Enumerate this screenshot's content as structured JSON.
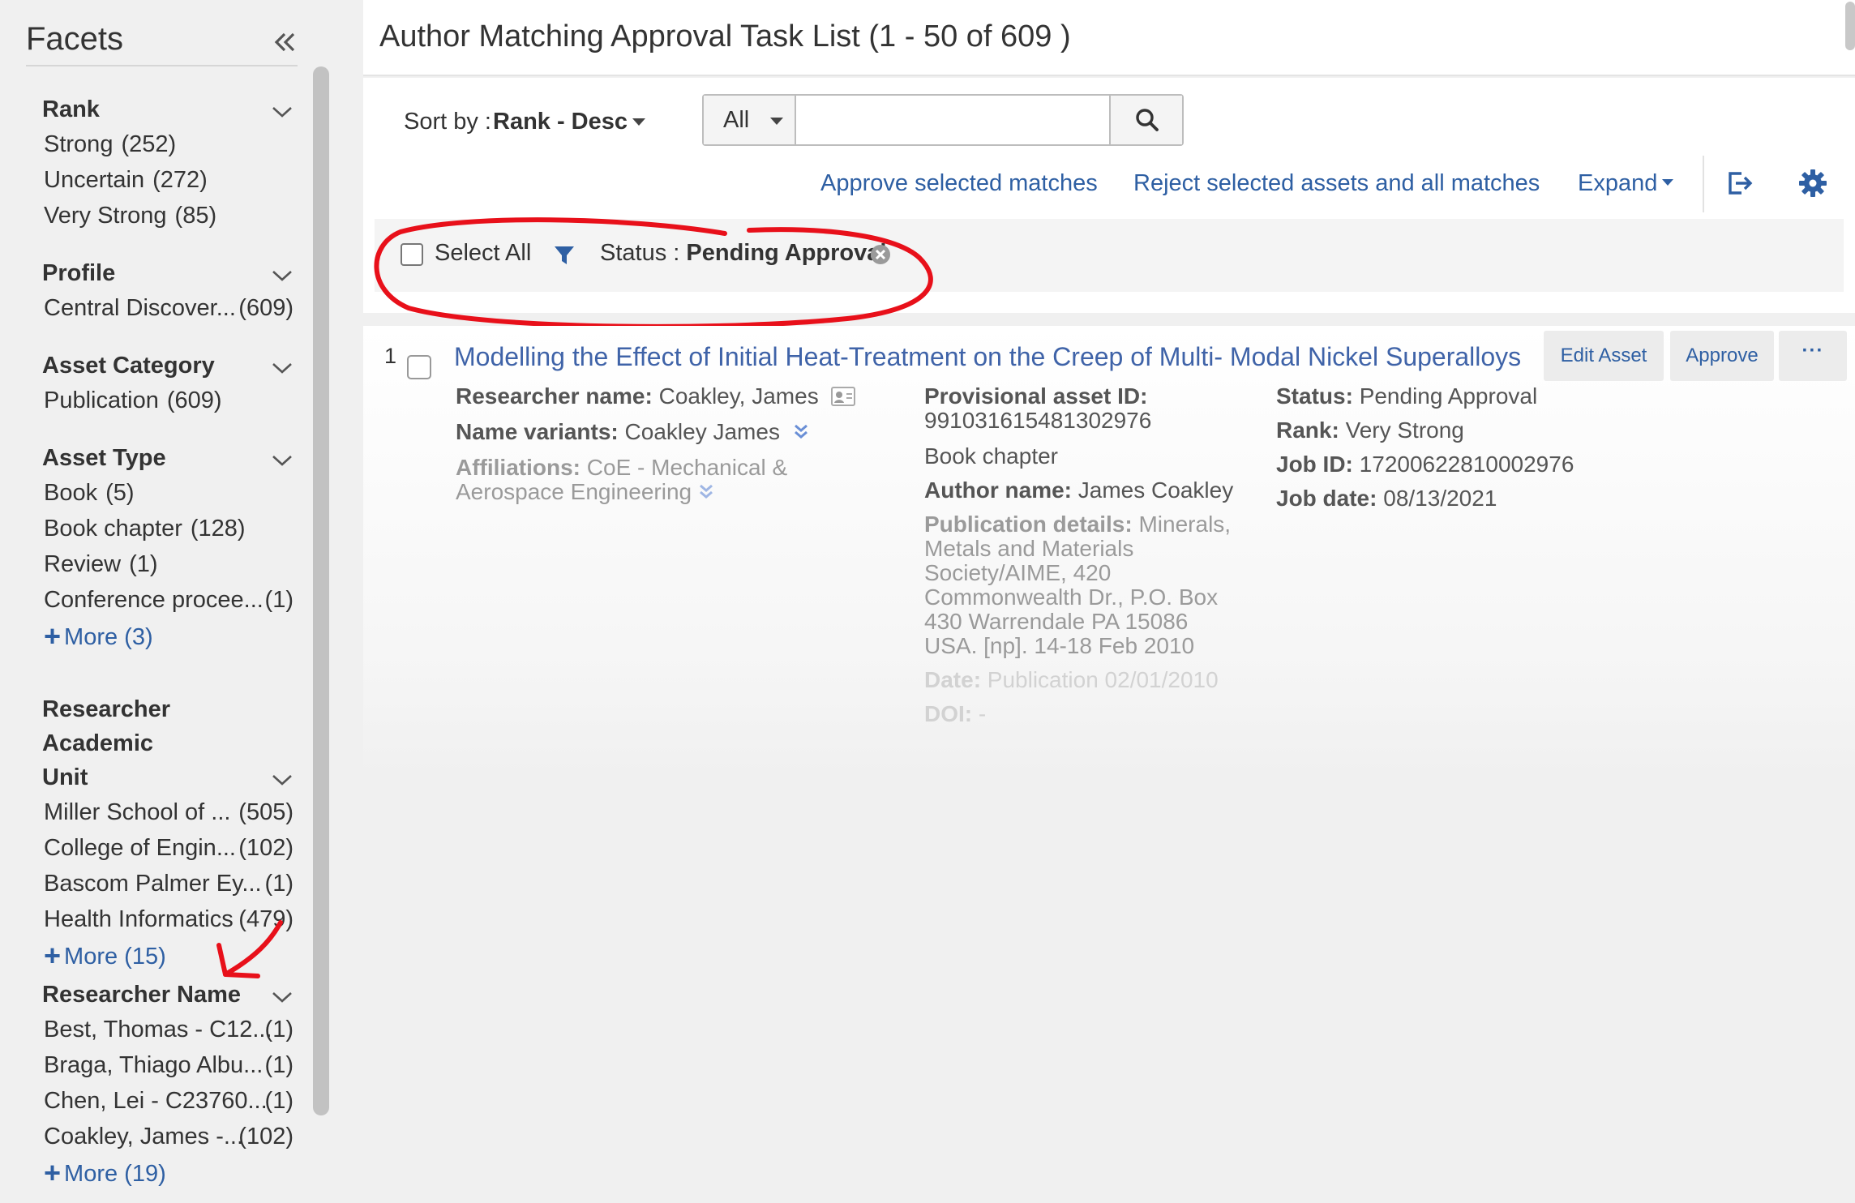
{
  "sidebar": {
    "title": "Facets",
    "facets": [
      {
        "title_lines": [
          "Rank"
        ],
        "items": [
          {
            "name": "Strong",
            "count": "(252)"
          },
          {
            "name": "Uncertain",
            "count": "(272)"
          },
          {
            "name": "Very Strong",
            "count": "(85)"
          }
        ]
      },
      {
        "title_lines": [
          "Profile"
        ],
        "items": [
          {
            "name": "Central Discover...",
            "count": "(609)"
          }
        ]
      },
      {
        "title_lines": [
          "Asset Category"
        ],
        "items": [
          {
            "name": "Publication",
            "count": "(609)"
          }
        ]
      },
      {
        "title_lines": [
          "Asset Type"
        ],
        "items": [
          {
            "name": "Book",
            "count": "(5)"
          },
          {
            "name": "Book chapter",
            "count": "(128)"
          },
          {
            "name": "Review",
            "count": "(1)"
          },
          {
            "name": "Conference procee...",
            "count": "(1)"
          }
        ],
        "more": "More (3)"
      },
      {
        "title_lines": [
          "Researcher Academic",
          "Unit"
        ],
        "items": [
          {
            "name": "Miller School of ...",
            "count": "(505)"
          },
          {
            "name": "College of Engin...",
            "count": "(102)"
          },
          {
            "name": "Bascom Palmer Ey...",
            "count": "(1)"
          },
          {
            "name": "Health Informatics",
            "count": "(479)"
          }
        ],
        "more": "More (15)"
      },
      {
        "title_lines": [
          "Researcher Name"
        ],
        "items": [
          {
            "name": "Best, Thomas - C12...",
            "count": "(1)"
          },
          {
            "name": "Braga, Thiago Albu...",
            "count": "(1)"
          },
          {
            "name": "Chen, Lei - C23760...",
            "count": "(1)"
          },
          {
            "name": "Coakley, James -...",
            "count": "(102)"
          }
        ],
        "more": "More (19)"
      }
    ]
  },
  "main": {
    "title": "Author Matching Approval Task List (1 - 50 of 609 )",
    "sort": {
      "label": "Sort by :",
      "value": "Rank - Desc"
    },
    "search": {
      "scope": "All",
      "value": "",
      "placeholder": ""
    },
    "actions": {
      "approve_selected": "Approve selected matches",
      "reject_selected": "Reject selected assets and all matches",
      "expand": "Expand"
    },
    "filter_bar": {
      "select_all": "Select All",
      "status_label": "Status : ",
      "status_value": "Pending Approval"
    }
  },
  "result": {
    "number": "1",
    "title": "Modelling the Effect of Initial Heat-Treatment on the Creep of Multi- Modal Nickel Superalloys",
    "buttons": {
      "edit": "Edit Asset",
      "approve": "Approve",
      "more": "···"
    },
    "researcher_name": {
      "label": "Researcher name:",
      "value": "Coakley, James"
    },
    "name_variants": {
      "label": "Name variants:",
      "value": "Coakley James"
    },
    "affiliations": {
      "label": "Affiliations:",
      "value_line1": "CoE - Mechanical &",
      "value_line2": "Aerospace Engineering"
    },
    "provisional_id": {
      "label": "Provisional asset ID:",
      "value": "991031615481302976"
    },
    "asset_type": "Book chapter",
    "author_name": {
      "label": "Author name:",
      "value": "James Coakley"
    },
    "publication_details": {
      "label": "Publication details:",
      "lines": [
        "Minerals,",
        "Metals and Materials",
        "Society/AIME, 420",
        "Commonwealth Dr., P.O. Box",
        "430 Warrendale PA 15086",
        "USA. [np]. 14-18 Feb 2010"
      ]
    },
    "date": {
      "label": "Date:",
      "value": "Publication 02/01/2010"
    },
    "doi": {
      "label": "DOI:",
      "value": "-"
    },
    "status": {
      "label": "Status:",
      "value": "Pending Approval"
    },
    "rank": {
      "label": "Rank:",
      "value": "Very Strong"
    },
    "job_id": {
      "label": "Job ID:",
      "value": "17200622810002976"
    },
    "job_date": {
      "label": "Job date:",
      "value": "08/13/2021"
    }
  },
  "colors": {
    "link": "#2e5fa3",
    "title_link": "#3f63a8",
    "annotation": "#e8101a",
    "sidebar_bg": "#f0f0f0"
  },
  "icons": [
    "collapse-double-left-icon",
    "chevron-down-icon",
    "plus-icon",
    "search-icon",
    "filter-icon",
    "remove-filter-icon",
    "export-icon",
    "settings-gear-icon",
    "researcher-card-icon",
    "double-chevron-down-icon"
  ]
}
